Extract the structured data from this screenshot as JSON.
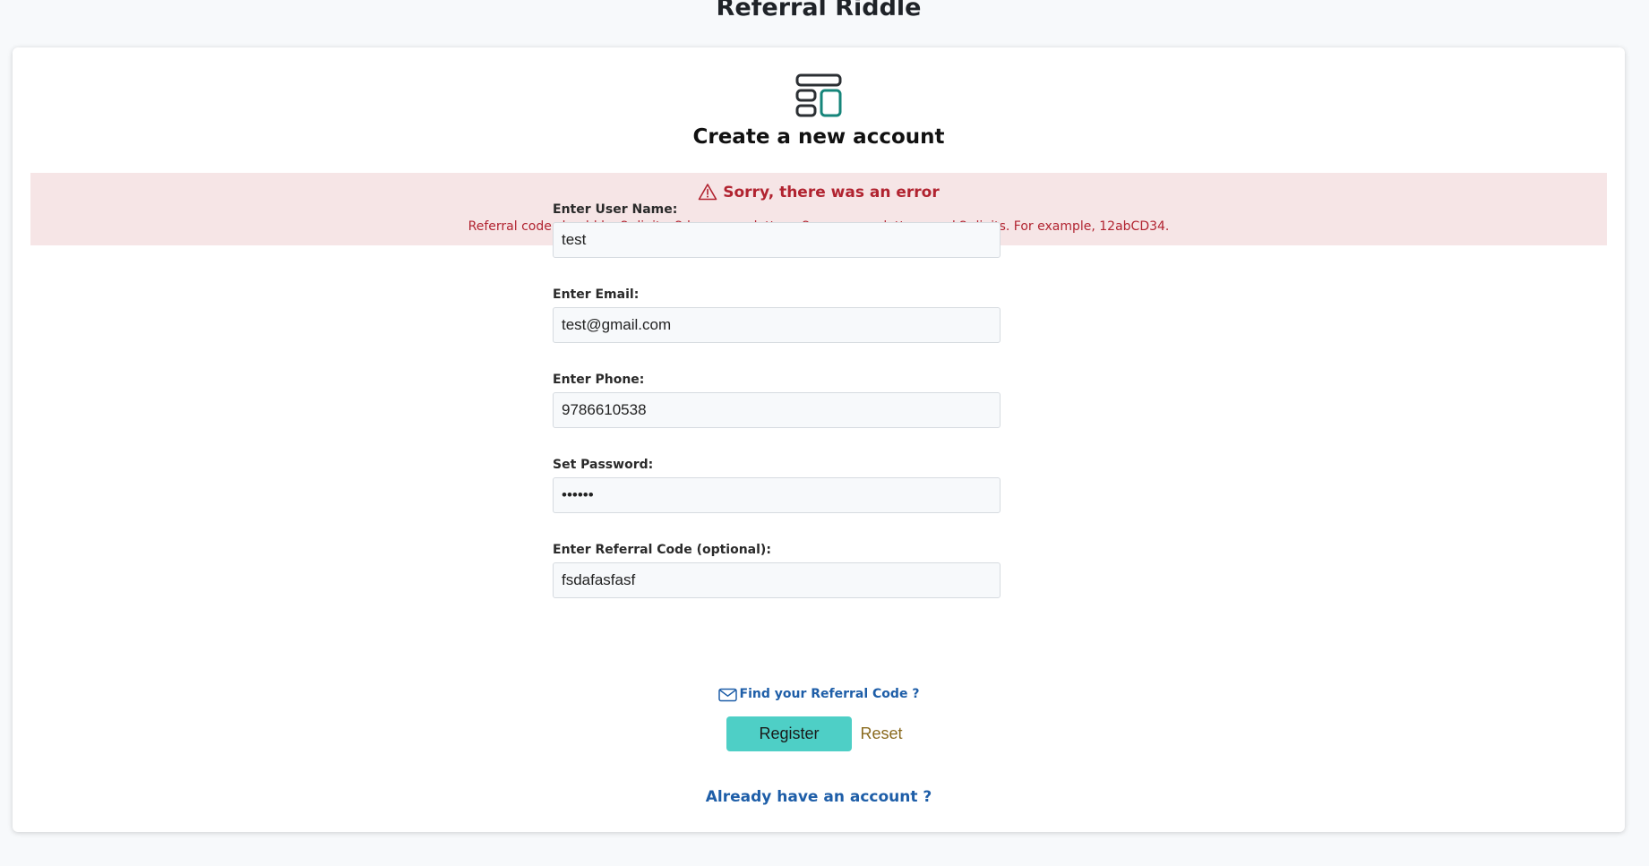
{
  "app": {
    "title": "Referral Riddle"
  },
  "card": {
    "heading": "Create a new account",
    "logo_icon": "layout-icon",
    "logo_colors": {
      "dark": "#2b2f33",
      "accent": "#16857a"
    }
  },
  "error": {
    "icon": "warning-triangle-icon",
    "title": "Sorry, there was an error",
    "message": "Referral code should be 2 digits, 2 lowercase letters, 2 uppercase letters, and 2 digits. For example, 12abCD34.",
    "color": "#b12330",
    "background": "#f6e5e6"
  },
  "form": {
    "fields": [
      {
        "label": "Enter User Name:",
        "value": "test",
        "type": "text"
      },
      {
        "label": "Enter Email:",
        "value": "test@gmail.com",
        "type": "text"
      },
      {
        "label": "Enter Phone:",
        "value": "9786610538",
        "type": "text"
      },
      {
        "label": "Set Password:",
        "value": "••••••",
        "type": "text"
      },
      {
        "label": "Enter Referral Code (optional):",
        "value": "fsdafasfasf",
        "type": "text"
      }
    ]
  },
  "links": {
    "find_referral": "Find your Referral Code ?",
    "find_referral_icon": "envelope-icon",
    "already_account": "Already have an account ?"
  },
  "buttons": {
    "register": "Register",
    "reset": "Reset",
    "register_color": "#4ecfc6"
  }
}
